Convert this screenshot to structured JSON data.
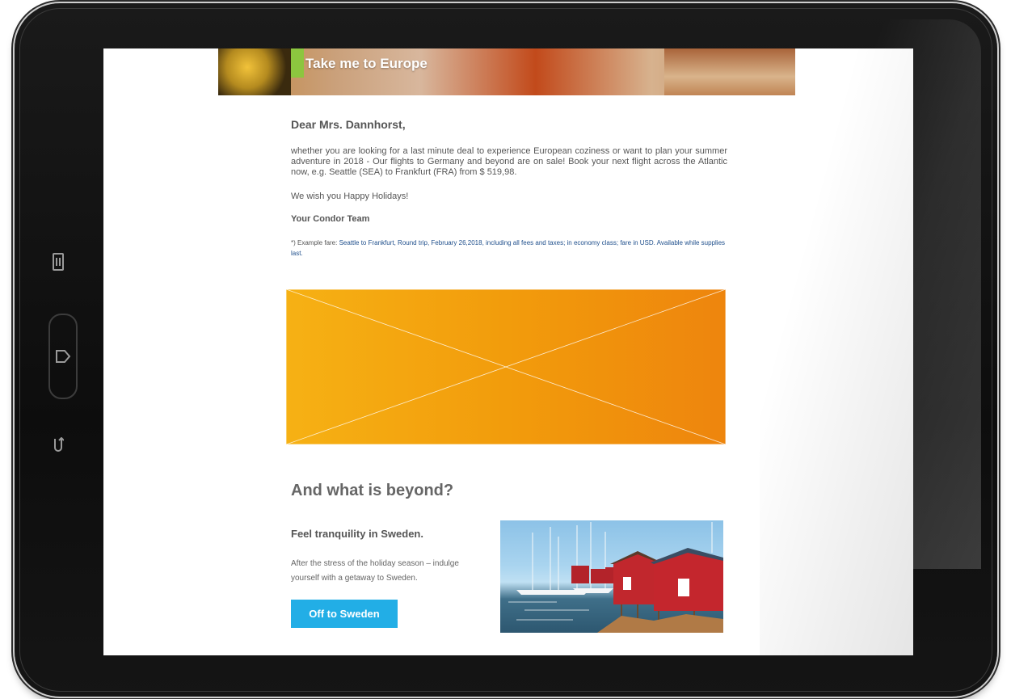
{
  "banner": {
    "title": "Take me to Europe"
  },
  "letter": {
    "greeting": "Dear Mrs. Dannhorst,",
    "body": "whether you are looking for a last minute deal to experience European coziness or want to plan your summer adventure in 2018 - Our flights to Germany and beyond are on sale! Book your next flight across the Atlantic now, e.g. Seattle (SEA) to Frankfurt (FRA) from $ 519,98.",
    "wish": "We wish you Happy Holidays!",
    "signoff": "Your Condor Team",
    "footnote_prefix": "*) Example fare: ",
    "footnote_link": "Seattle to Frankfurt, Round trip, February 26,2018, including all fees and taxes; in economy class; fare in USD. Available while supplies last."
  },
  "beyond": {
    "title": "And what is beyond?",
    "subtitle": "Feel tranquility in Sweden.",
    "text": "After the stress of the holiday season – indulge yourself with a getaway to Sweden.",
    "cta_label": "Off to Sweden"
  },
  "colors": {
    "accent_green": "#8cc63f",
    "cta_blue": "#22aee6",
    "promo_orange_start": "#f6b114",
    "promo_orange_end": "#ee850d",
    "link_blue": "#1f4f8c"
  },
  "device": {
    "side_icons": [
      "recent-apps-icon",
      "home-icon",
      "back-icon"
    ]
  }
}
